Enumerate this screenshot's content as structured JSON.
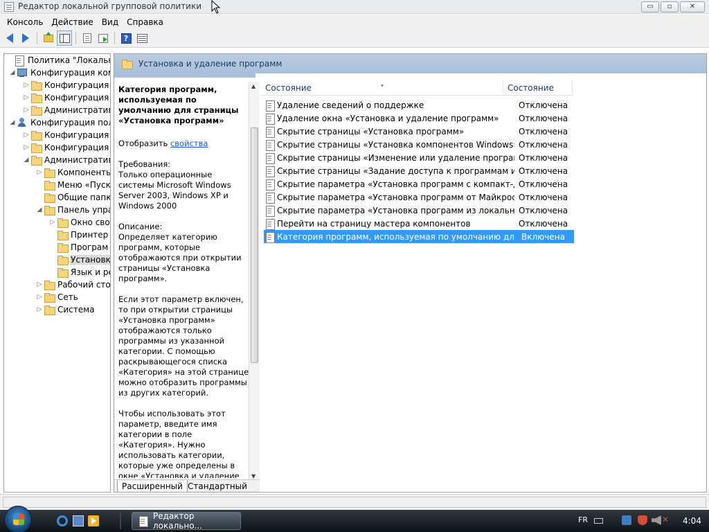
{
  "window": {
    "title": "Редактор локальной групповой политики",
    "buttons": {
      "minimize": "▭",
      "maximize": "▫",
      "close": "✕"
    }
  },
  "menu": {
    "items": [
      {
        "label": "Консоль"
      },
      {
        "label": "Действие"
      },
      {
        "label": "Вид"
      },
      {
        "label": "Справка"
      }
    ]
  },
  "toolbar": {
    "icons": [
      "back-icon",
      "forward-icon",
      "up-folder-icon",
      "show-hide-tree-icon",
      "properties-icon",
      "export-list-icon",
      "help-icon",
      "filter-icon"
    ],
    "help_glyph": "?"
  },
  "tree": {
    "items": [
      {
        "label": "Политика \"Локальный",
        "icon": "doc",
        "twisty": ""
      },
      {
        "label": "Конфигурация комп",
        "icon": "computer",
        "twisty": "◢"
      },
      {
        "label": "Конфигурация п",
        "icon": "folder",
        "twisty": "▷"
      },
      {
        "label": "Конфигурация W",
        "icon": "folder",
        "twisty": "▷"
      },
      {
        "label": "Административ",
        "icon": "folder",
        "twisty": "▷"
      },
      {
        "label": "Конфигурация поль",
        "icon": "user",
        "twisty": "◢"
      },
      {
        "label": "Конфигурация п",
        "icon": "folder",
        "twisty": "▷"
      },
      {
        "label": "Конфигурация W",
        "icon": "folder",
        "twisty": "▷"
      },
      {
        "label": "Административ",
        "icon": "folder",
        "twisty": "◢"
      },
      {
        "label": "Компоненты",
        "icon": "folder",
        "twisty": "▷"
      },
      {
        "label": "Меню «Пуск",
        "icon": "folder",
        "twisty": ""
      },
      {
        "label": "Общие папк",
        "icon": "folder",
        "twisty": ""
      },
      {
        "label": "Панель упра",
        "icon": "folder",
        "twisty": "◢"
      },
      {
        "label": "Окно сво",
        "icon": "folder",
        "twisty": "▷"
      },
      {
        "label": "Принтер",
        "icon": "folder",
        "twisty": ""
      },
      {
        "label": "Програм",
        "icon": "folder",
        "twisty": ""
      },
      {
        "label": "Установк",
        "icon": "folder",
        "twisty": ""
      },
      {
        "label": "Язык и ре",
        "icon": "folder",
        "twisty": ""
      },
      {
        "label": "Рабочий сто",
        "icon": "folder",
        "twisty": "▷"
      },
      {
        "label": "Сеть",
        "icon": "folder",
        "twisty": "▷"
      },
      {
        "label": "Система",
        "icon": "folder",
        "twisty": "▷"
      }
    ]
  },
  "header": {
    "title": "Установка и удаление программ"
  },
  "extended": {
    "title": "Категория программ, используемая по умолчанию для страницы «Установка программ»",
    "display_prefix": "Отобразить ",
    "display_link": "свойства",
    "requirements": "Требования:\nТолько операционные системы Microsoft Windows Server 2003, Windows XP и Windows 2000",
    "description": "Описание:\nОпределяет категорию программ, которые отображаются при открытии страницы «Установка программ».",
    "para1": "Если этот параметр включен, то при открытии страницы «Установка программ» отображаются только программы из указанной категории. С помощью раскрывающегося списка «Категория» на этой странице можно отобразить программы из других категорий.",
    "para2": "Чтобы использовать этот параметр, введите имя категории в поле «Категория». Нужно использовать категории, которые уже определены в окне «Установка и удаление программ». Для определения категории используется «Установка",
    "scroll_up": "▲",
    "scroll_down": "▼"
  },
  "list": {
    "columns": {
      "name": "Состояние",
      "state": "Состояние"
    },
    "rows": [
      {
        "name": "Удаление сведений о поддержке",
        "state": "Отключена"
      },
      {
        "name": "Удаление окна «Установка и удаление программ»",
        "state": "Отключена"
      },
      {
        "name": "Скрытие страницы «Установка программ»",
        "state": "Отключена"
      },
      {
        "name": "Скрытие страницы «Установка компонентов Windows»",
        "state": "Отключена"
      },
      {
        "name": "Скрытие страницы «Изменение или удаление программ»",
        "state": "Отключена"
      },
      {
        "name": "Скрытие страницы «Задание доступа к программам и па...",
        "state": "Отключена"
      },
      {
        "name": "Скрытие параметра «Установка программ с компакт-дис...",
        "state": "Отключена"
      },
      {
        "name": "Скрытие параметра «Установка программ от Майкросо...",
        "state": "Отключена"
      },
      {
        "name": "Скрытие параметра «Установка программ из локальной ...",
        "state": "Отключена"
      },
      {
        "name": "Перейти на страницу мастера компонентов",
        "state": "Отключена"
      },
      {
        "name": "Категория программ, используемая по умолчанию для с...",
        "state": "Включена",
        "selected": true
      }
    ]
  },
  "tabs": {
    "extended": "Расширенный",
    "standard": "Стандартный"
  },
  "taskbar": {
    "window_button": "Редактор локально...",
    "language": "FR",
    "clock": "4:04"
  }
}
